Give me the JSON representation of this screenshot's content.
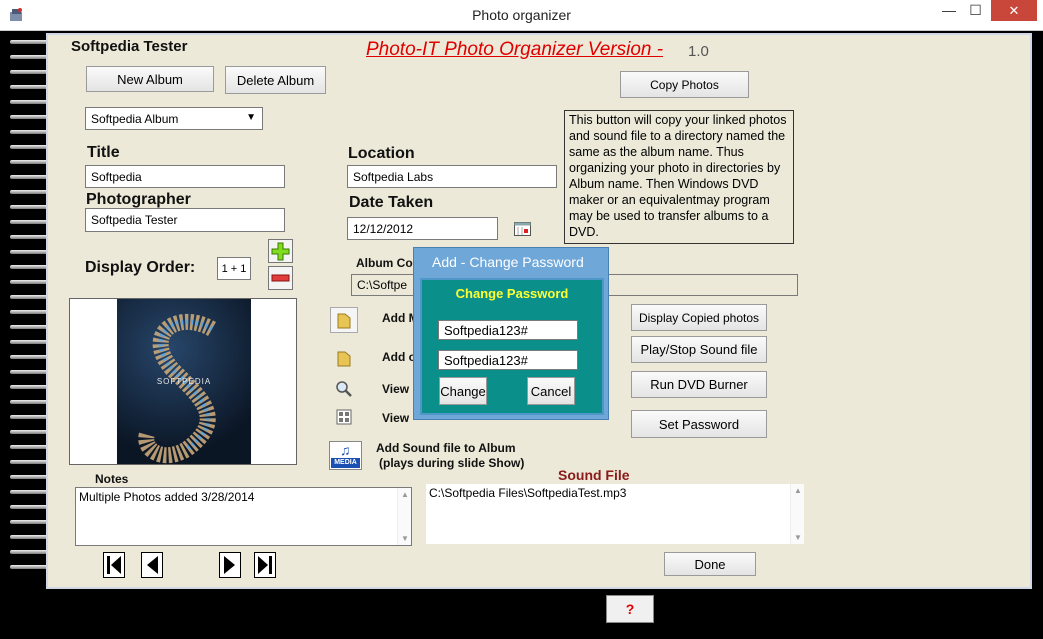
{
  "window": {
    "title": "Photo organizer",
    "minimize_symbol": "—",
    "maximize_symbol": "☐",
    "close_symbol": "✕"
  },
  "header": {
    "user_name": "Softpedia Tester",
    "app_heading": "Photo-IT  Photo Organizer Version -",
    "version": "1.0"
  },
  "album": {
    "new_album_label": "New Album",
    "delete_album_label": "Delete Album",
    "selected_album": "Softpedia Album",
    "copy_photos_label": "Copy Photos",
    "copy_info": "This button will copy your linked photos and sound file to a directory named the same as the album name. Thus organizing your photo in directories by Album name. Then Windows DVD maker  or an equivalentmay program may be used to transfer albums to a DVD."
  },
  "fields": {
    "title_label": "Title",
    "title_value": "Softpedia",
    "photographer_label": "Photographer",
    "photographer_value": "Softpedia Tester",
    "location_label": "Location",
    "location_value": "Softpedia Labs",
    "date_label": "Date Taken",
    "date_value": "12/12/2012",
    "display_order_label": "Display Order:",
    "display_order_value": "1 + 1",
    "album_copy_label": "Album Co",
    "album_copy_path": "C:\\Softpe"
  },
  "actions": {
    "add_m_label": "Add M",
    "add_o_label": "Add o",
    "view1_label": "View",
    "view2_label": "View",
    "add_sound_line1": "Add Sound file to Album",
    "add_sound_line2": "(plays during slide Show)",
    "media_icon_text": "MEDIA",
    "display_copied_label": "Display Copied photos",
    "play_stop_label": "Play/Stop Sound file",
    "run_dvd_label": "Run DVD Burner",
    "set_password_label": "Set Password",
    "done_label": "Done",
    "help_label": "?"
  },
  "notes": {
    "label": "Notes",
    "text": "Multiple Photos added 3/28/2014"
  },
  "sound": {
    "label": "Sound File",
    "path": "C:\\Softpedia Files\\SoftpediaTest.mp3"
  },
  "dialog": {
    "title": "Add - Change Password",
    "heading": "Change Password",
    "password1": "Softpedia123#",
    "password2": "Softpedia123#",
    "change_label": "Change",
    "cancel_label": "Cancel"
  },
  "photo": {
    "caption": "SOFTPEDIA"
  },
  "colors": {
    "heading_red": "#e00000",
    "panel_bg": "#ece9d8",
    "dialog_teal": "#0a8f8a",
    "dialog_heading_yellow": "#ffff33",
    "sound_label": "#8b1a1a"
  }
}
